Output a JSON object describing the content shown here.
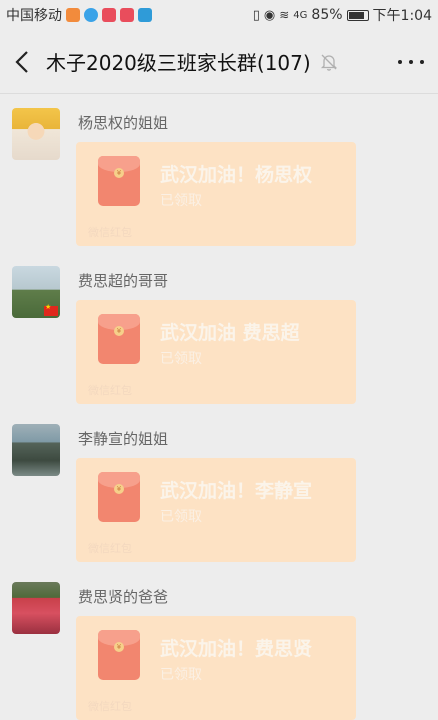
{
  "status_bar": {
    "carrier": "中国移动",
    "battery_percent": "85%",
    "time": "下午1:04",
    "signal": "4G"
  },
  "header": {
    "title": "木子2020级三班家长群(107)",
    "back_icon": "chevron-left-icon",
    "mute_icon": "bell-off-icon",
    "more_icon": "more-dots-icon"
  },
  "messages": [
    {
      "sender": "杨思权的姐姐",
      "text": "武汉加油！杨思权",
      "status": "已领取",
      "footer": "微信红包"
    },
    {
      "sender": "费思超的哥哥",
      "text": "武汉加油  费思超",
      "status": "已领取",
      "footer": "微信红包"
    },
    {
      "sender": "李静宣的姐姐",
      "text": "武汉加油！李静宣",
      "status": "已领取",
      "footer": "微信红包"
    },
    {
      "sender": "费思贤的爸爸",
      "text": "武汉加油！费思贤",
      "status": "已领取",
      "footer": "微信红包"
    }
  ],
  "colors": {
    "background": "#ededed",
    "packet_bg": "#fde2c4",
    "packet_icon": "#f2866f"
  }
}
